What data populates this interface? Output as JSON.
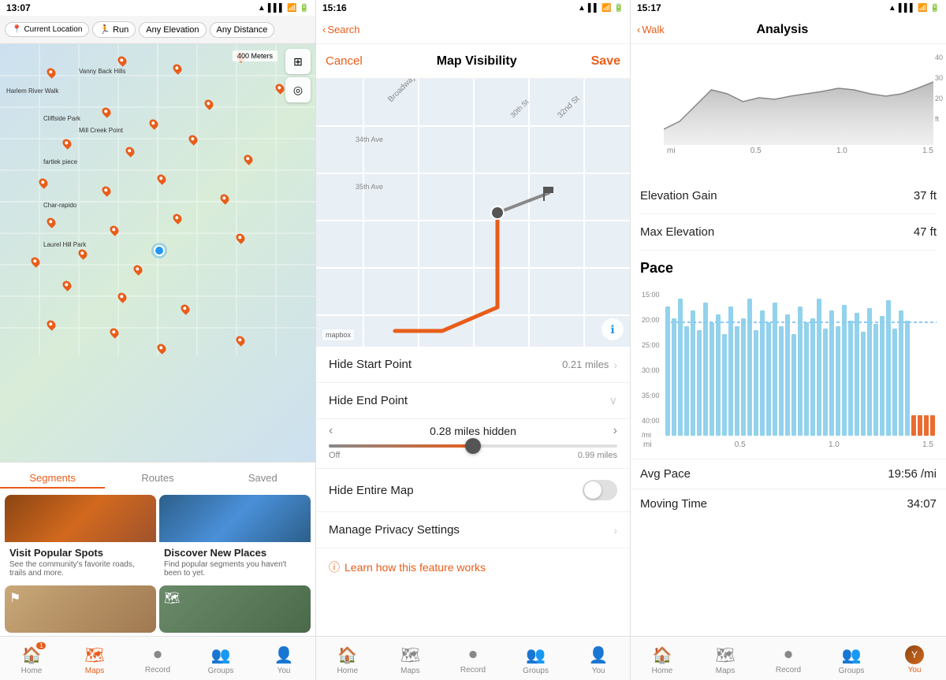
{
  "panel1": {
    "status_time": "13:07",
    "location_label": "Current Location",
    "filter_run": "Run",
    "filter_elevation": "Any Elevation",
    "filter_distance": "Any Distance",
    "filter_any": "Any",
    "segment_tabs": [
      "Segments",
      "Routes",
      "Saved"
    ],
    "active_tab": "Segments",
    "card1_title": "Visit Popular Spots",
    "card1_desc": "See the community's favorite roads, trails and more.",
    "card2_title": "Discover New Places",
    "card2_desc": "Find popular segments you haven't been to yet.",
    "nav_home": "Home",
    "nav_maps": "Maps",
    "nav_record": "Record",
    "nav_groups": "Groups",
    "nav_you": "You",
    "home_badge": "1"
  },
  "panel2": {
    "status_time": "15:16",
    "nav_back": "Search",
    "title": "Map Visibility",
    "cancel": "Cancel",
    "save": "Save",
    "hide_start_label": "Hide Start Point",
    "hide_start_value": "0.21 miles",
    "hide_end_label": "Hide End Point",
    "hidden_value": "0.28 miles hidden",
    "range_off": "Off",
    "range_max": "0.99 miles",
    "hide_map_label": "Hide Entire Map",
    "manage_label": "Manage Privacy Settings",
    "learn_text": "Learn how this feature works",
    "nav_home": "Home",
    "nav_maps": "Maps",
    "nav_record": "Record",
    "nav_groups": "Groups",
    "nav_you": "You"
  },
  "panel3": {
    "status_time": "15:17",
    "nav_back": "Walk",
    "title": "Analysis",
    "elevation_labels": [
      "40",
      "30",
      "20",
      "ft"
    ],
    "elev_xaxis": [
      "mi",
      "0.5",
      "1.0",
      "1.5"
    ],
    "elevation_gain_label": "Elevation Gain",
    "elevation_gain_value": "37 ft",
    "max_elevation_label": "Max Elevation",
    "max_elevation_value": "47 ft",
    "pace_title": "Pace",
    "pace_yaxis": [
      "15:00",
      "20:00",
      "25:00",
      "30:00",
      "35:00",
      "40:00"
    ],
    "pace_unit": "/mi",
    "pace_xaxis": [
      "mi",
      "0.5",
      "1.0",
      "1.5"
    ],
    "avg_pace_label": "Avg Pace",
    "avg_pace_value": "19:56 /mi",
    "moving_time_label": "Moving Time",
    "moving_time_value": "34:07",
    "nav_home": "Home",
    "nav_maps": "Maps",
    "nav_record": "Record",
    "nav_groups": "Groups",
    "nav_you": "You"
  }
}
